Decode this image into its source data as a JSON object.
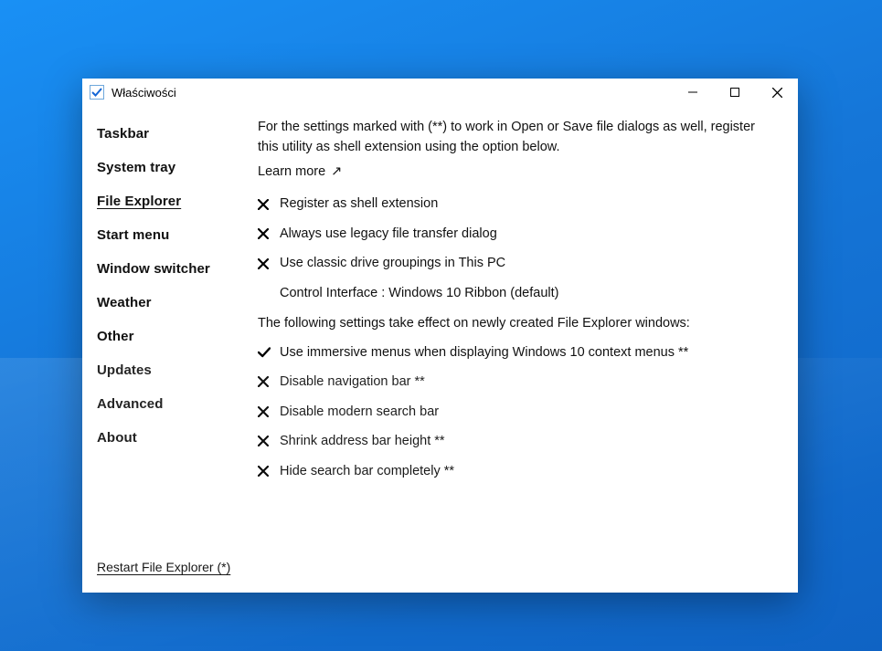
{
  "window": {
    "title": "Właściwości"
  },
  "sidebar": {
    "items": [
      {
        "label": "Taskbar",
        "selected": false
      },
      {
        "label": "System tray",
        "selected": false
      },
      {
        "label": "File Explorer",
        "selected": true
      },
      {
        "label": "Start menu",
        "selected": false
      },
      {
        "label": "Window switcher",
        "selected": false
      },
      {
        "label": "Weather",
        "selected": false
      },
      {
        "label": "Other",
        "selected": false
      },
      {
        "label": "Updates",
        "selected": false
      },
      {
        "label": "Advanced",
        "selected": false
      },
      {
        "label": "About",
        "selected": false
      }
    ],
    "restart_label": "Restart File Explorer (*)"
  },
  "content": {
    "intro": "For the settings marked with (**) to work in Open or Save file dialogs as well, register this utility as shell extension using the option below.",
    "learn_more": "Learn more",
    "settings_top": [
      {
        "state": "off",
        "label": "Register as shell extension"
      },
      {
        "state": "off",
        "label": "Always use legacy file transfer dialog"
      },
      {
        "state": "off",
        "label": "Use classic drive groupings in This PC"
      },
      {
        "state": "none",
        "label": "Control Interface : Windows 10 Ribbon (default)"
      }
    ],
    "section_note": "The following settings take effect on newly created File Explorer windows:",
    "settings_bottom": [
      {
        "state": "on",
        "label": "Use immersive menus when displaying Windows 10 context menus **"
      },
      {
        "state": "off",
        "label": "Disable navigation bar **"
      },
      {
        "state": "off",
        "label": "Disable modern search bar"
      },
      {
        "state": "off",
        "label": "Shrink address bar height **"
      },
      {
        "state": "off",
        "label": "Hide search bar completely **"
      }
    ]
  }
}
